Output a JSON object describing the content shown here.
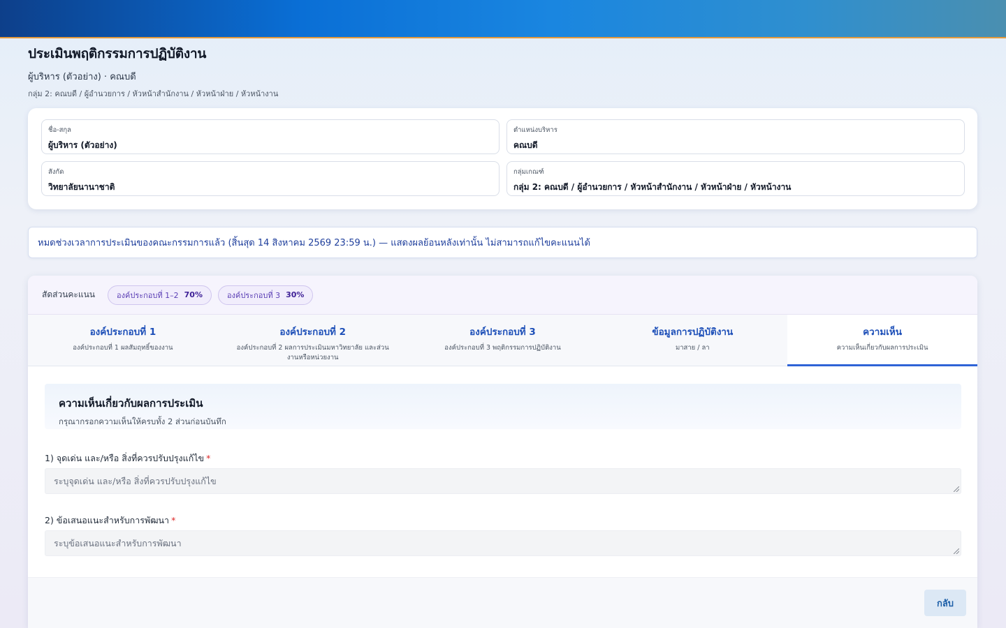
{
  "header": {
    "title": "ประเมินพฤติกรรมการปฏิบัติงาน",
    "subtitle": "ผู้บริหาร (ตัวอย่าง) · คณบดี",
    "group": "กลุ่ม 2: คณบดี / ผู้อำนวยการ / หัวหน้าสำนักงาน / หัวหน้าฝ่าย / หัวหน้างาน"
  },
  "info": {
    "name_label": "ชื่อ-สกุล",
    "name_value": "ผู้บริหาร (ตัวอย่าง)",
    "position_label": "ตำแหน่งบริหาร",
    "position_value": "คณบดี",
    "affiliation_label": "สังกัด",
    "affiliation_value": "วิทยาลัยนานาชาติ",
    "group_label": "กลุ่มเกณฑ์",
    "group_value": "กลุ่ม 2: คณบดี / ผู้อำนวยการ / หัวหน้าสำนักงาน / หัวหน้าฝ่าย / หัวหน้างาน"
  },
  "alert": {
    "text": "หมดช่วงเวลาการประเมินของคณะกรรมการแล้ว (สิ้นสุด 14 สิงหาคม 2569 23:59 น.) — แสดงผลย้อนหลังเท่านั้น ไม่สามารถแก้ไขคะแนนได้"
  },
  "ratio": {
    "label": "สัดส่วนคะแนน",
    "chips": [
      {
        "label": "องค์ประกอบที่ 1–2",
        "pct": "70%"
      },
      {
        "label": "องค์ประกอบที่ 3",
        "pct": "30%"
      }
    ]
  },
  "tabs": [
    {
      "title": "องค์ประกอบที่ 1",
      "desc": "องค์ประกอบที่ 1 ผลสัมฤทธิ์ของงาน"
    },
    {
      "title": "องค์ประกอบที่ 2",
      "desc": "องค์ประกอบที่ 2 ผลการประเมินมหาวิทยาลัย และส่วนงานหรือหน่วยงาน"
    },
    {
      "title": "องค์ประกอบที่ 3",
      "desc": "องค์ประกอบที่ 3 พฤติกรรมการปฏิบัติงาน"
    },
    {
      "title": "ข้อมูลการปฏิบัติงาน",
      "desc": "มาสาย / ลา"
    },
    {
      "title": "ความเห็น",
      "desc": "ความเห็นเกี่ยวกับผลการประเมิน"
    }
  ],
  "active_tab": 4,
  "panel": {
    "title": "ความเห็นเกี่ยวกับผลการประเมิน",
    "subtitle": "กรุณากรอกความเห็นให้ครบทั้ง 2 ส่วนก่อนบันทึก",
    "q1_label": "1) จุดเด่น และ/หรือ สิ่งที่ควรปรับปรุงแก้ไข",
    "q1_placeholder": "ระบุจุดเด่น และ/หรือ สิ่งที่ควรปรับปรุงแก้ไข",
    "q2_label": "2) ข้อเสนอแนะสำหรับการพัฒนา",
    "q2_placeholder": "ระบุข้อเสนอแนะสำหรับการพัฒนา",
    "required_mark": "*"
  },
  "footer": {
    "back_label": "กลับ"
  }
}
